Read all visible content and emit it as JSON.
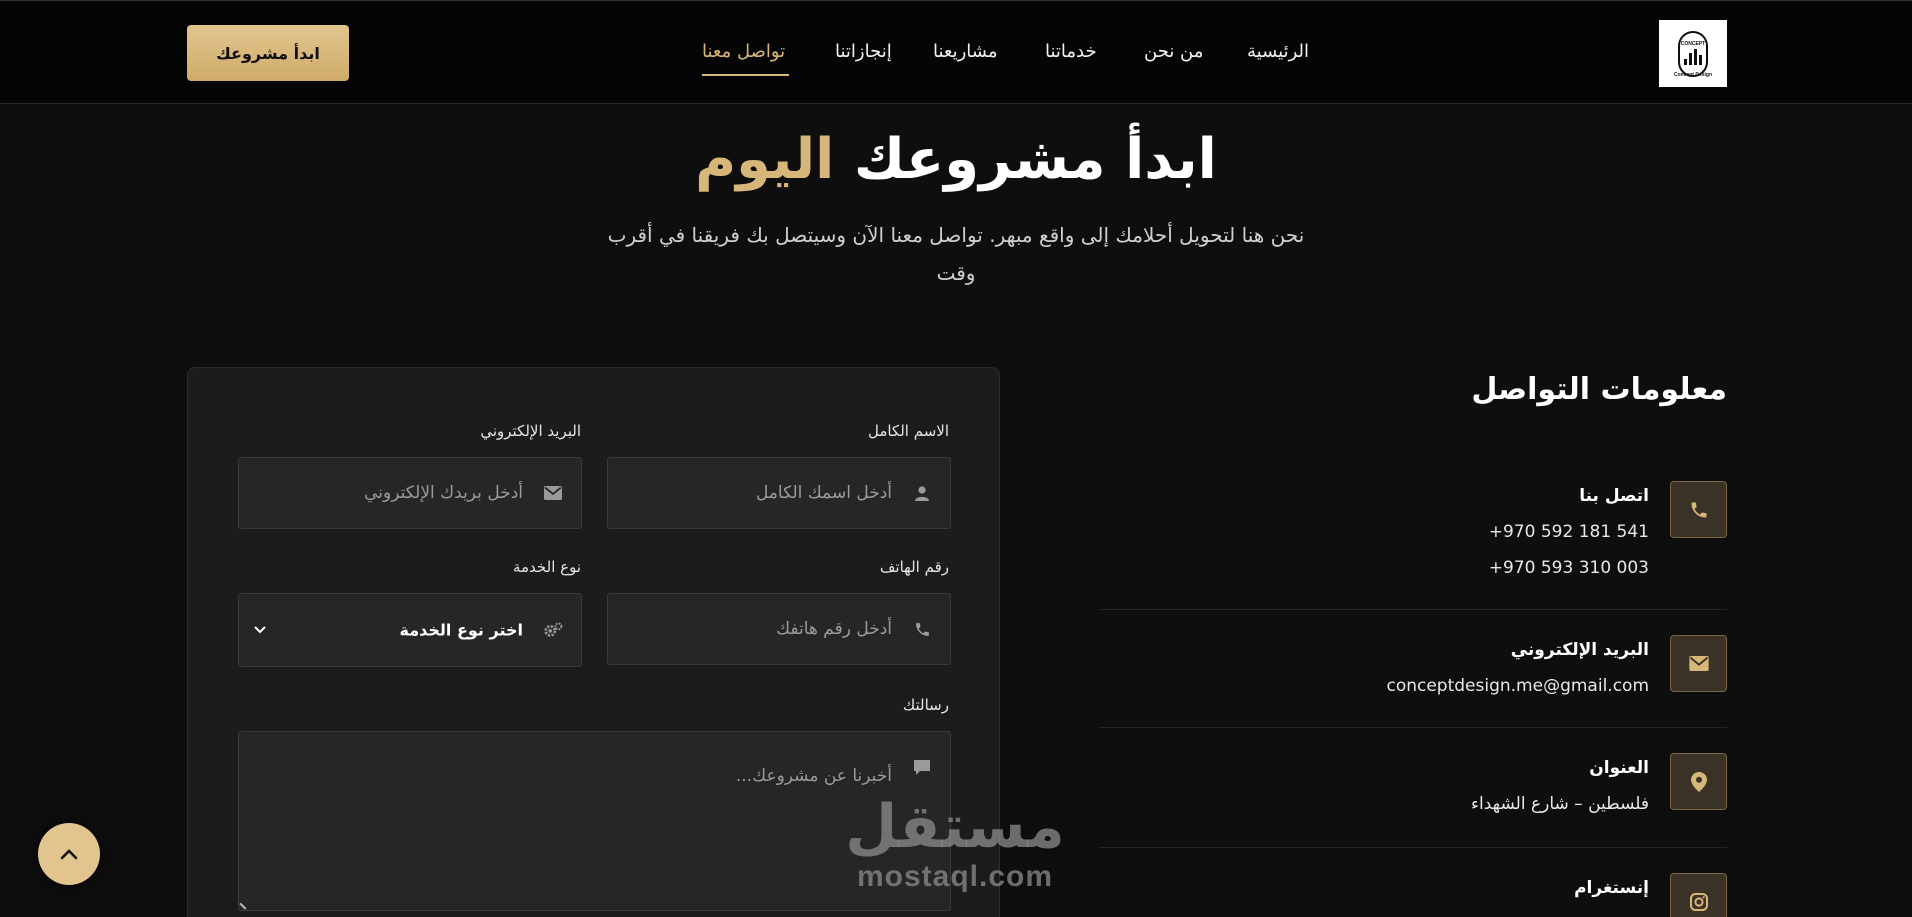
{
  "nav": {
    "logo_text": "CONCEPT",
    "logo_name": "Concept Design",
    "links": [
      "الرئيسية",
      "من نحن",
      "خدماتنا",
      "مشاريعنا",
      "إنجازاتنا",
      "تواصل معنا"
    ],
    "active_index": 5,
    "cta_label": "ابدأ مشروعك"
  },
  "hero": {
    "title_main": "ابدأ مشروعك",
    "title_accent": "اليوم",
    "subtitle": "نحن هنا لتحويل أحلامك إلى واقع مبهر. تواصل معنا الآن وسيتصل بك فريقنا في أقرب وقت"
  },
  "form": {
    "name_label": "الاسم الكامل",
    "name_placeholder": "أدخل اسمك الكامل",
    "email_label": "البريد الإلكتروني",
    "email_placeholder": "أدخل بريدك الإلكتروني",
    "phone_label": "رقم الهاتف",
    "phone_placeholder": "أدخل رقم هاتفك",
    "service_label": "نوع الخدمة",
    "service_selected": "اختر نوع الخدمة",
    "message_label": "رسالتك",
    "message_placeholder": "أخبرنا عن مشروعك..."
  },
  "contact": {
    "title": "معلومات التواصل",
    "phone_label": "اتصل بنا",
    "phones": [
      "+970 592 181 541",
      "+970 593 310 003"
    ],
    "email_label": "البريد الإلكتروني",
    "email": "conceptdesign.me@gmail.com",
    "address_label": "العنوان",
    "address": "فلسطين – شارع الشهداء",
    "instagram_label": "إنستغرام"
  },
  "watermark": {
    "arabic": "مستقل",
    "latin": "mostaql.com"
  },
  "colors": {
    "accent": "#d7b679",
    "background": "#0e0e0e",
    "card": "#1c1c1c"
  },
  "icons": {
    "phone": "phone-icon",
    "envelope": "envelope-icon",
    "location": "map-pin-icon",
    "instagram": "instagram-icon",
    "user": "user-icon",
    "gears": "gears-icon",
    "comment": "comment-icon",
    "chevron": "chevron-down-icon",
    "arrow_up": "arrow-up-icon"
  }
}
